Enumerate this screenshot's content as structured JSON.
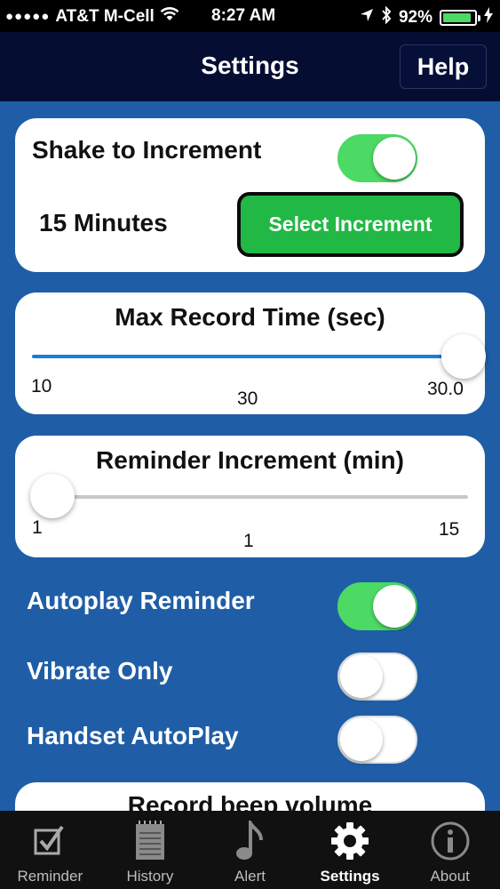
{
  "status_bar": {
    "signal": "●●●●●",
    "carrier": "AT&T M-Cell",
    "time": "8:27 AM",
    "battery": "92%",
    "battery_level": 0.92
  },
  "nav": {
    "title": "Settings",
    "help_label": "Help"
  },
  "shake": {
    "label": "Shake to Increment",
    "toggle_on": true,
    "increment_value": "15 Minutes",
    "select_button": "Select Increment"
  },
  "max_record": {
    "title": "Max Record Time (sec)",
    "min_label": "10",
    "max_label": "30.0",
    "current_label": "30",
    "value": 30,
    "min": 10,
    "max": 30
  },
  "reminder_increment": {
    "title": "Reminder Increment (min)",
    "min_label": "1",
    "max_label": "15",
    "current_label": "1",
    "value": 1,
    "min": 1,
    "max": 15
  },
  "options": [
    {
      "label": "Autoplay Reminder",
      "on": true
    },
    {
      "label": "Vibrate Only",
      "on": false
    },
    {
      "label": "Handset AutoPlay",
      "on": false
    }
  ],
  "record_beep": {
    "title": "Record beep volume"
  },
  "tabs": [
    {
      "label": "Reminder",
      "icon": "checkbox-icon",
      "active": false
    },
    {
      "label": "History",
      "icon": "notepad-icon",
      "active": false
    },
    {
      "label": "Alert",
      "icon": "music-note-icon",
      "active": false
    },
    {
      "label": "Settings",
      "icon": "gear-icon",
      "active": true
    },
    {
      "label": "About",
      "icon": "info-icon",
      "active": false
    }
  ],
  "colors": {
    "background": "#1f5ea6",
    "navbar": "#050d33",
    "toggle_on": "#4cd964",
    "select_button": "#22b845",
    "slider_fill": "#1a7fd4"
  }
}
